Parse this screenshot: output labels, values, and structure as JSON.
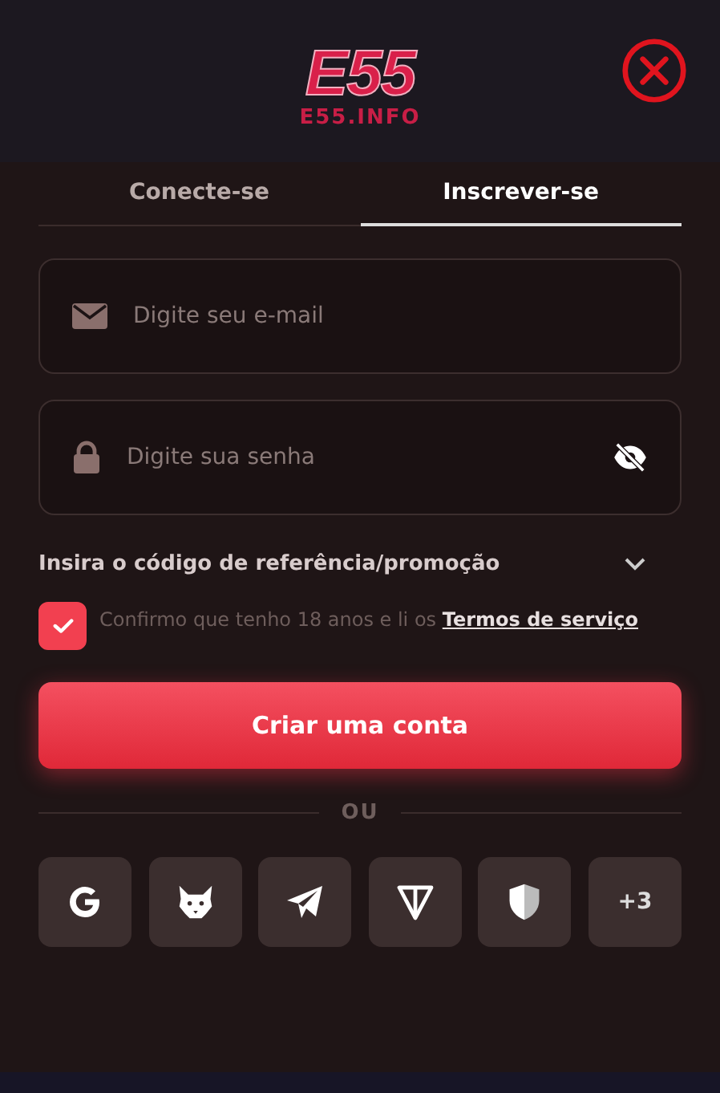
{
  "header": {
    "logo": "E55",
    "logo_subtitle": "E55.INFO"
  },
  "tabs": [
    {
      "label": "Conecte-se",
      "selected": false
    },
    {
      "label": "Inscrever-se",
      "selected": true
    }
  ],
  "fields": [
    {
      "kind": "email",
      "placeholder": "Digite seu e-mail"
    },
    {
      "kind": "password",
      "placeholder": "Digite sua senha"
    }
  ],
  "promo": {
    "label": "Insira o código de referência/promoção",
    "expanded": false
  },
  "terms": {
    "checked": true,
    "text": "Confirmo que tenho 18 anos e li os ",
    "link": "Termos de serviço"
  },
  "submit": "Criar uma conta",
  "divider": "OU",
  "social": [
    {
      "kind": "google"
    },
    {
      "kind": "fox"
    },
    {
      "kind": "telegram"
    },
    {
      "kind": "ton"
    },
    {
      "kind": "shield"
    },
    {
      "kind": "more",
      "label": "+3"
    }
  ]
}
